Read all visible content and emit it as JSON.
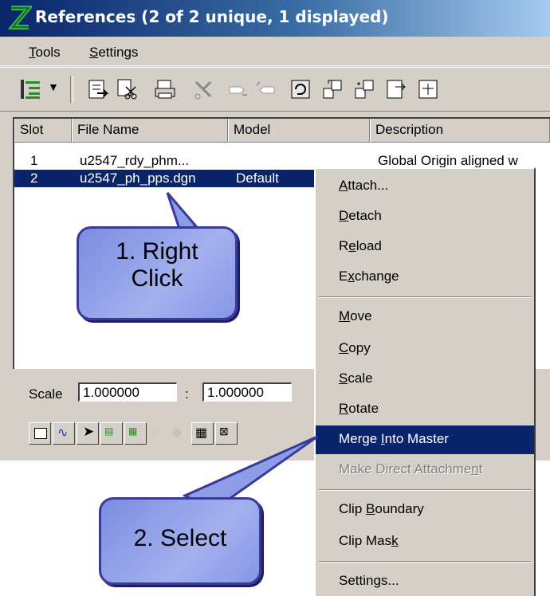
{
  "window": {
    "title": "References (2 of 2 unique, 1 displayed)"
  },
  "menubar": {
    "items": [
      "Tools",
      "Settings"
    ]
  },
  "columns": [
    "Slot",
    "File Name",
    "Model",
    "Description"
  ],
  "rows": [
    {
      "slot": "1",
      "file": "u2547_rdy_phm...",
      "model": "",
      "description": "Global Origin aligned w"
    },
    {
      "slot": "2",
      "file": "u2547_ph_pps.dgn",
      "model": "Default",
      "description": ""
    }
  ],
  "scale": {
    "label": "Scale",
    "value1": "1.000000",
    "separator": ":",
    "value2": "1.000000"
  },
  "context_menu": {
    "items": [
      {
        "label": "Attach...",
        "underline": "A"
      },
      {
        "label": "Detach",
        "underline": "D"
      },
      {
        "label": "Reload",
        "underline": "e"
      },
      {
        "label": "Exchange",
        "underline": "x"
      },
      {
        "label": "Move",
        "underline": "M"
      },
      {
        "label": "Copy",
        "underline": "C"
      },
      {
        "label": "Scale",
        "underline": "S"
      },
      {
        "label": "Rotate",
        "underline": "R"
      },
      {
        "label": "Merge Into Master",
        "underline": "I"
      },
      {
        "label": "Make Direct Attachment",
        "underline": "n"
      },
      {
        "label": "Clip Boundary",
        "underline": "B"
      },
      {
        "label": "Clip Mask",
        "underline": "k"
      },
      {
        "label": "Settings...",
        "underline": ""
      }
    ],
    "highlighted": "Merge Into Master",
    "disabled": "Make Direct Attachment"
  },
  "callouts": {
    "step1_line1": "1. Right",
    "step1_line2": "Click",
    "step2": "2. Select"
  },
  "colors": {
    "selection": "#0a246a",
    "callout_fill": "#8e9de8",
    "callout_border": "#3a3a9a"
  }
}
